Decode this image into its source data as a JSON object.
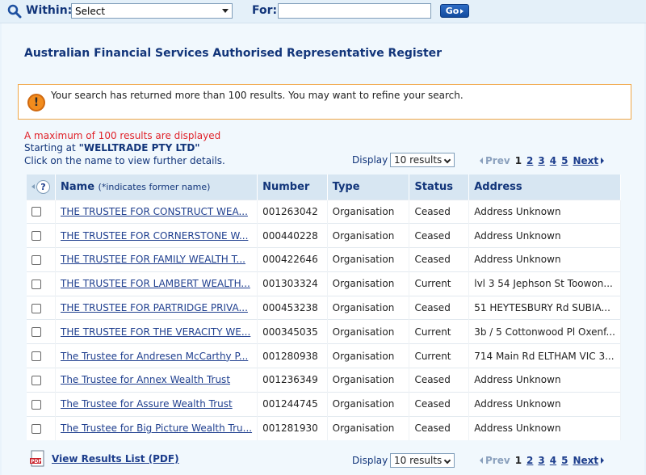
{
  "search": {
    "within_label": "Within:",
    "within_value": "Select",
    "for_label": "For:",
    "for_value": "",
    "go_label": "Go"
  },
  "page": {
    "title": "Australian Financial Services Authorised Representative Register"
  },
  "warning": {
    "text": "Your search has returned more than 100 results. You may want to refine your search."
  },
  "messages": {
    "max": "A maximum of 100 results are displayed",
    "starting_prefix": "Starting at",
    "starting_value": "\"WELLTRADE PTY LTD\"",
    "click": "Click on the name to view further details."
  },
  "pager": {
    "display_label": "Display",
    "display_value": "10 results",
    "prev": "Prev",
    "pages": [
      "1",
      "2",
      "3",
      "4",
      "5"
    ],
    "current": "1",
    "next": "Next"
  },
  "table": {
    "headers": {
      "help": "?",
      "name": "Name",
      "name_note": "(*indicates former name)",
      "number": "Number",
      "type": "Type",
      "status": "Status",
      "address": "Address"
    },
    "rows": [
      {
        "name": "THE TRUSTEE FOR CONSTRUCT WEA...",
        "number": "001263042",
        "type": "Organisation",
        "status": "Ceased",
        "address": "Address Unknown"
      },
      {
        "name": "THE TRUSTEE FOR CORNERSTONE W...",
        "number": "000440228",
        "type": "Organisation",
        "status": "Ceased",
        "address": "Address Unknown"
      },
      {
        "name": "THE TRUSTEE FOR FAMILY WEALTH T...",
        "number": "000422646",
        "type": "Organisation",
        "status": "Ceased",
        "address": "Address Unknown"
      },
      {
        "name": "THE TRUSTEE FOR LAMBERT WEALTH...",
        "number": "001303324",
        "type": "Organisation",
        "status": "Current",
        "address": "lvl 3 54 Jephson St Toowon..."
      },
      {
        "name": "THE TRUSTEE FOR PARTRIDGE PRIVA...",
        "number": "000453238",
        "type": "Organisation",
        "status": "Ceased",
        "address": "51 HEYTESBURY Rd SUBIA..."
      },
      {
        "name": "THE TRUSTEE FOR THE VERACITY WE...",
        "number": "000345035",
        "type": "Organisation",
        "status": "Current",
        "address": "3b / 5 Cottonwood Pl Oxenf..."
      },
      {
        "name": "The Trustee for Andresen McCarthy P...",
        "number": "001280938",
        "type": "Organisation",
        "status": "Current",
        "address": "714 Main Rd ELTHAM VIC 3..."
      },
      {
        "name": "The Trustee for Annex Wealth Trust",
        "number": "001236349",
        "type": "Organisation",
        "status": "Ceased",
        "address": "Address Unknown"
      },
      {
        "name": "The Trustee for Assure Wealth Trust",
        "number": "001244745",
        "type": "Organisation",
        "status": "Ceased",
        "address": "Address Unknown"
      },
      {
        "name": "The Trustee for Big Picture Wealth Tru...",
        "number": "001281930",
        "type": "Organisation",
        "status": "Ceased",
        "address": "Address Unknown"
      }
    ]
  },
  "pdf": {
    "label": "View Results List (PDF)"
  },
  "colors": {
    "brand_navy": "#12357a",
    "link_blue": "#1f3f8f",
    "warn_orange": "#f28c1d",
    "error_red": "#e0222a"
  }
}
